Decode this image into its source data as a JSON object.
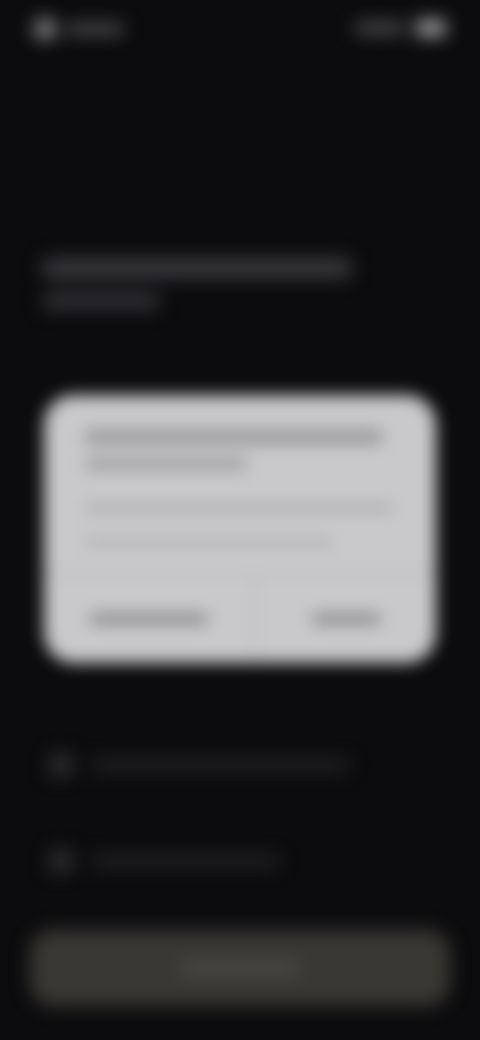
{
  "status_bar": {
    "time": "",
    "signal_icon": "signal-icon",
    "battery_icon": "battery-icon"
  },
  "background": {
    "heading": "",
    "rows": [
      {
        "icon": "info-icon",
        "label": ""
      },
      {
        "icon": "info-icon",
        "label": ""
      }
    ],
    "primary_button_label": ""
  },
  "dialog": {
    "title": "",
    "body": "",
    "buttons": [
      {
        "label": ""
      },
      {
        "label": ""
      }
    ]
  },
  "colors": {
    "background": "#0c0c0e",
    "dialog": "#c9c9cb",
    "button": "#3a3833"
  }
}
